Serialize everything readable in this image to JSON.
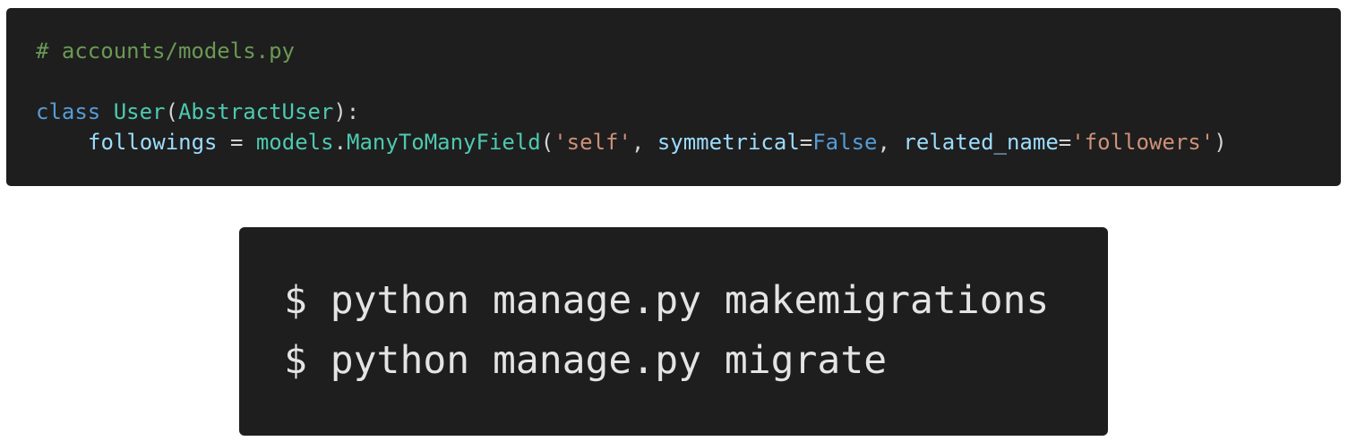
{
  "code_snippet": {
    "comment": "# accounts/models.py",
    "line2": {
      "keyword": "class",
      "class_name": "User",
      "open_paren": "(",
      "base_class": "AbstractUser",
      "close": "):"
    },
    "line3": {
      "field_name": "followings",
      "equals": " = ",
      "module": "models",
      "dot": ".",
      "field_type": "ManyToManyField",
      "open_paren": "(",
      "arg_self": "'self'",
      "sep1": ", ",
      "kw_symmetrical": "symmetrical",
      "eq1": "=",
      "val_false": "False",
      "sep2": ", ",
      "kw_related_name": "related_name",
      "eq2": "=",
      "val_followers": "'followers'",
      "close_paren": ")"
    }
  },
  "terminal": {
    "commands": [
      "$ python manage.py makemigrations",
      "$ python manage.py migrate"
    ]
  },
  "colors": {
    "background": "#1e1e1e",
    "comment": "#6a9955",
    "keyword": "#569cd6",
    "class": "#4ec9b0",
    "string": "#ce9178",
    "variable": "#9cdcfe",
    "text": "#d4d4d4"
  }
}
